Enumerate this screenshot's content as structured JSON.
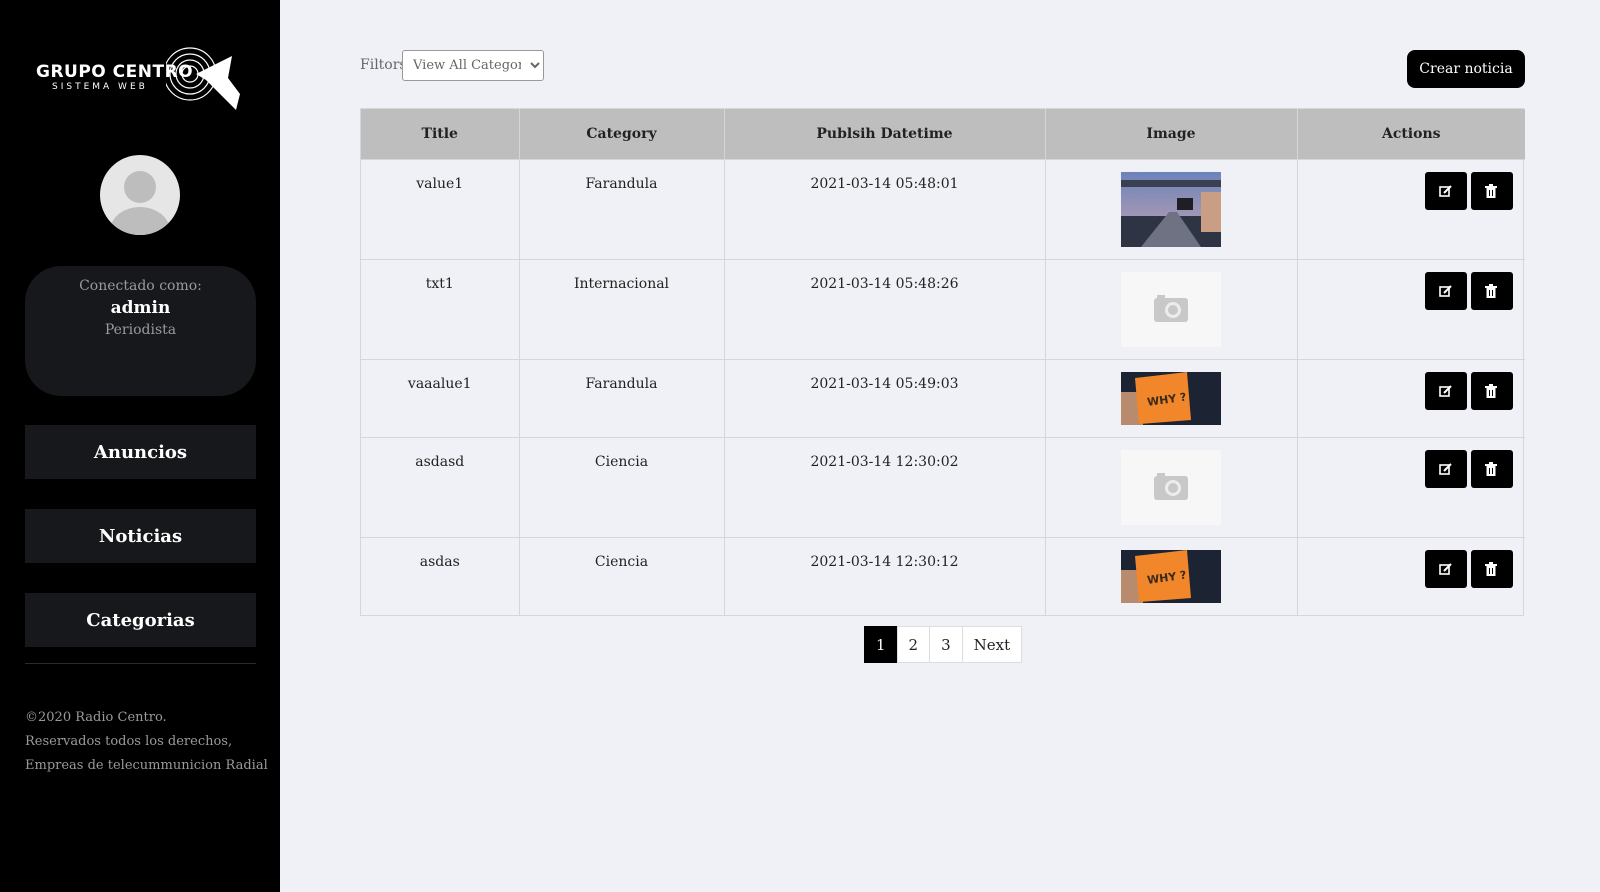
{
  "brand": {
    "title": "GRUPO CENTRO",
    "subtitle": "SISTEMA WEB"
  },
  "user": {
    "connected_label": "Conectado como:",
    "name": "admin",
    "role": "Periodista"
  },
  "nav": [
    {
      "label": "Anuncios"
    },
    {
      "label": "Noticias"
    },
    {
      "label": "Categorias"
    }
  ],
  "footer": {
    "line1": "©2020 Radio Centro.",
    "line2": "Reservados todos los derechos,",
    "line3": "Empreas de telecummunicion Radial"
  },
  "filters": {
    "label": "Filtors",
    "selected": "View All Category"
  },
  "create_button": "Crear noticia",
  "table": {
    "headers": [
      "Title",
      "Category",
      "Publsih Datetime",
      "Image",
      "Actions"
    ],
    "rows": [
      {
        "title": "value1",
        "category": "Farandula",
        "datetime": "2021-03-14 05:48:01",
        "image": "bridge-photo"
      },
      {
        "title": "txt1",
        "category": "Internacional",
        "datetime": "2021-03-14 05:48:26",
        "image": "placeholder-camera"
      },
      {
        "title": "vaaalue1",
        "category": "Farandula",
        "datetime": "2021-03-14 05:49:03",
        "image": "why-sign-photo"
      },
      {
        "title": "asdasd",
        "category": "Ciencia",
        "datetime": "2021-03-14 12:30:02",
        "image": "placeholder-camera"
      },
      {
        "title": "asdas",
        "category": "Ciencia",
        "datetime": "2021-03-14 12:30:12",
        "image": "why-sign-photo"
      }
    ],
    "why_text": "WHY ?"
  },
  "pagination": {
    "pages": [
      "1",
      "2",
      "3"
    ],
    "next": "Next",
    "current": "1"
  },
  "colors": {
    "sidebar": "#000000",
    "panel": "#17181b",
    "header": "#bebebe",
    "background": "#f0f1f6"
  }
}
